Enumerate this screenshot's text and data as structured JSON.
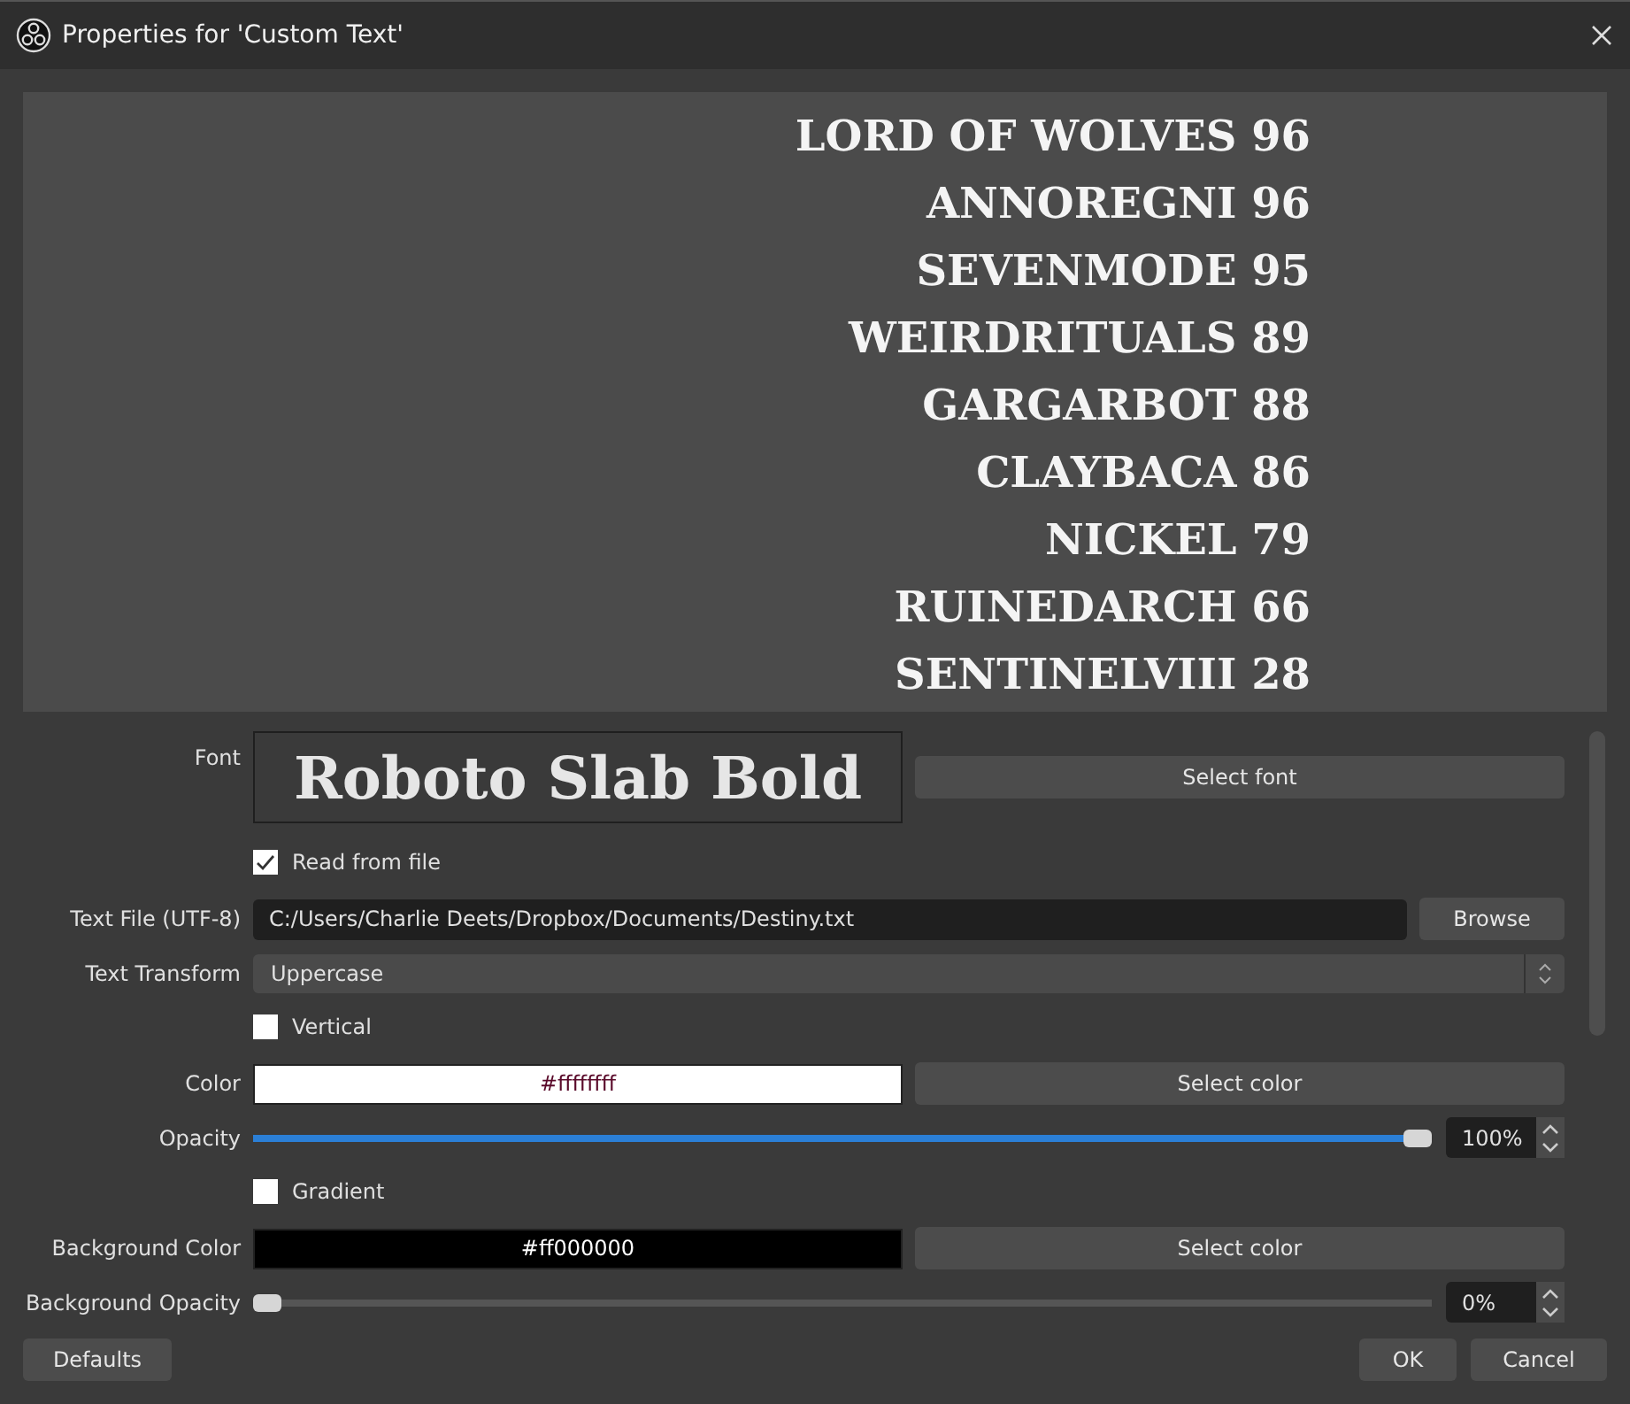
{
  "window": {
    "title": "Properties for 'Custom Text'"
  },
  "preview": {
    "lines": [
      "LORD OF WOLVES 96",
      "ANNOREGNI 96",
      "SEVENMODE 95",
      "WEIRDRITUALS 89",
      "GARGARBOT 88",
      "CLAYBACA 86",
      "NICKEL 79",
      "RUINEDARCH 66",
      "SENTINELVIII 28"
    ]
  },
  "properties": [
    {
      "kind": "font",
      "label": "Font",
      "value": "Roboto Slab Bold",
      "button": "Select font"
    },
    {
      "kind": "checkbox",
      "label": "Read from file",
      "checked": true
    },
    {
      "kind": "file",
      "label": "Text File (UTF-8)",
      "value": "C:/Users/Charlie Deets/Dropbox/Documents/Destiny.txt",
      "button": "Browse"
    },
    {
      "kind": "select",
      "label": "Text Transform",
      "value": "Uppercase"
    },
    {
      "kind": "checkbox",
      "label": "Vertical",
      "checked": false
    },
    {
      "kind": "color",
      "label": "Color",
      "value": "#ffffffff",
      "button": "Select color"
    },
    {
      "kind": "slider",
      "label": "Opacity",
      "level": 1,
      "reading": "100%"
    },
    {
      "kind": "checkbox",
      "label": "Gradient",
      "checked": false
    },
    {
      "kind": "color",
      "label": "Background Color",
      "value": "#ff000000",
      "button": "Select color"
    },
    {
      "kind": "slider",
      "label": "Background Opacity",
      "level": 0,
      "reading": "0%"
    }
  ],
  "buttons": {
    "defaults": "Defaults",
    "ok": "OK",
    "cancel": "Cancel"
  }
}
